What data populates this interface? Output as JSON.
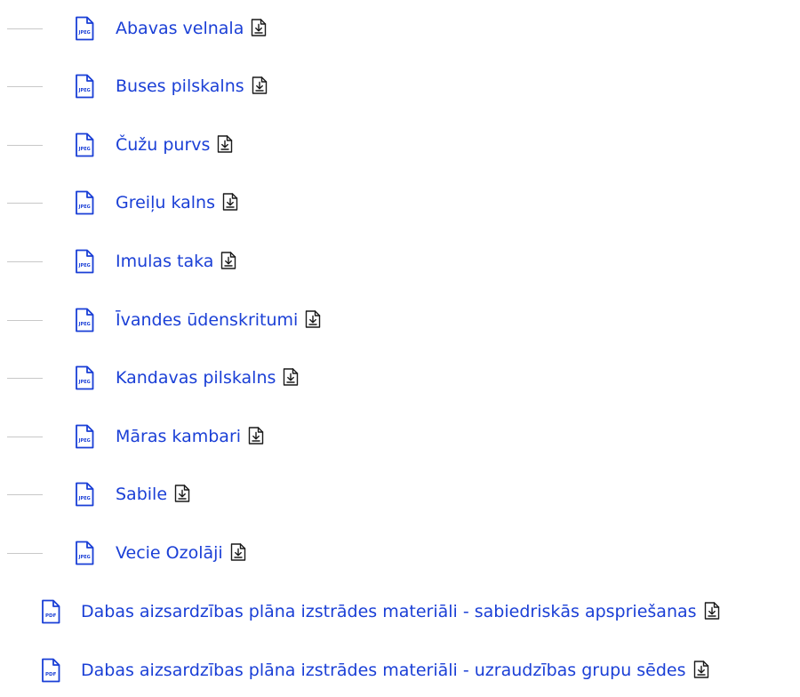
{
  "colors": {
    "link": "#1a3fd6",
    "icon_stroke": "#1a3fd6",
    "tree_line": "#c8c8c8"
  },
  "child_files": [
    {
      "name": "Abavas velnala",
      "type": "JPEG"
    },
    {
      "name": "Buses pilskalns",
      "type": "JPEG"
    },
    {
      "name": "Čužu purvs",
      "type": "JPEG"
    },
    {
      "name": "Greiļu kalns",
      "type": "JPEG"
    },
    {
      "name": "Imulas taka",
      "type": "JPEG"
    },
    {
      "name": "Īvandes ūdenskritumi",
      "type": "JPEG"
    },
    {
      "name": "Kandavas pilskalns",
      "type": "JPEG"
    },
    {
      "name": "Māras kambari",
      "type": "JPEG"
    },
    {
      "name": "Sabile",
      "type": "JPEG"
    },
    {
      "name": "Vecie Ozolāji",
      "type": "JPEG"
    }
  ],
  "top_files": [
    {
      "name": "Dabas aizsardzības plāna izstrādes materiāli - sabiedriskās apspriešanas",
      "type": "PDF"
    },
    {
      "name": "Dabas aizsardzības plāna izstrādes materiāli - uzraudzības grupu sēdes",
      "type": "PDF"
    }
  ],
  "icons": {
    "file_icon": "document-icon",
    "download_icon": "download-icon"
  }
}
